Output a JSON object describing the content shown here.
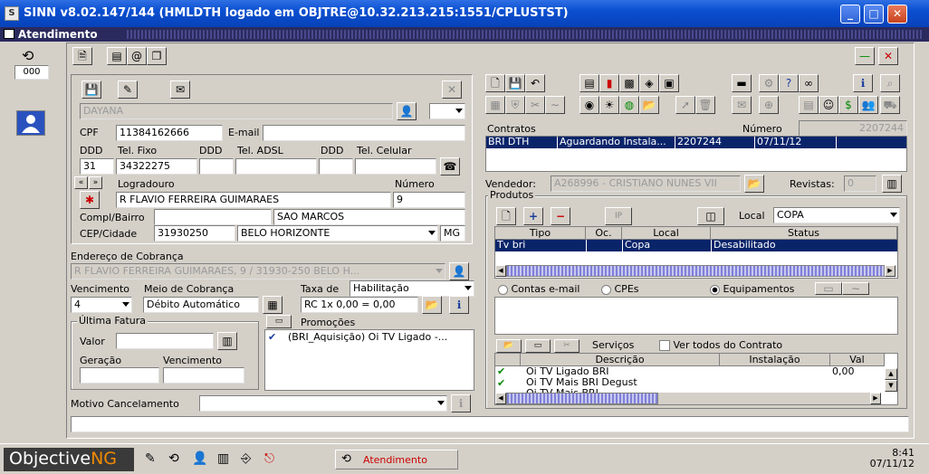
{
  "window": {
    "title": "SINN v8.02.147/144    (HMLDTH logado em OBJTRE@10.32.213.215:1551/CPLUSTST)",
    "subtitle": "Atendimento"
  },
  "left": {
    "counter": "000"
  },
  "customer": {
    "name": "DAYANA",
    "cpf_label": "CPF",
    "cpf": "11384162666",
    "email_label": "E-mail",
    "email": "",
    "ddd_label": "DDD",
    "tel_fixo_label": "Tel. Fixo",
    "ddd2_label": "DDD",
    "tel_adsl_label": "Tel. ADSL",
    "ddd3_label": "DDD",
    "tel_cel_label": "Tel. Celular",
    "ddd": "31",
    "tel_fixo": "34322275",
    "logradouro_label": "Logradouro",
    "numero_label": "Número",
    "logradouro": "R FLAVIO FERREIRA GUIMARAES",
    "numero": "9",
    "compl_label": "Compl/Bairro",
    "bairro": "SAO MARCOS",
    "cep_label": "CEP/Cidade",
    "cep": "31930250",
    "cidade": "BELO HORIZONTE",
    "uf": "MG"
  },
  "billing": {
    "endereco_label": "Endereço de Cobrança",
    "endereco": "R FLAVIO FERREIRA GUIMARAES, 9  / 31930-250 BELO H...",
    "vencimento_label": "Vencimento",
    "meio_label": "Meio de Cobrança",
    "taxa_label": "Taxa de",
    "taxa_value": "Habilitação",
    "vencimento": "4",
    "meio": "Débito Automático",
    "rc": "RC 1x 0,00 = 0,00",
    "ultima_fatura_label": "Última Fatura",
    "valor_label": "Valor",
    "geracao_label": "Geração",
    "venc2_label": "Vencimento",
    "promocoes_label": "Promoções",
    "promo_item": "(BRI_Aquisição) Oi TV Ligado -...",
    "motivo_label": "Motivo Cancelamento"
  },
  "contracts": {
    "label": "Contratos",
    "numero_label": "Número",
    "numero": "2207244",
    "row": [
      "BRI DTH",
      "Aguardando Instala...",
      "2207244",
      "07/11/12"
    ],
    "vendedor_label": "Vendedor:",
    "vendedor": "A268996 - CRISTIANO NUNES VII",
    "revistas_label": "Revistas:",
    "revistas": "0"
  },
  "produtos": {
    "label": "Produtos",
    "local_label": "Local",
    "local_value": "COPA",
    "headers": [
      "Tipo",
      "Oc.",
      "Local",
      "Status"
    ],
    "row": [
      "Tv bri",
      "",
      "Copa",
      "Desabilitado"
    ],
    "radio_contas": "Contas e-mail",
    "radio_cpes": "CPEs",
    "radio_equip": "Equipamentos"
  },
  "servicos": {
    "label": "Serviços",
    "ver_todos": "Ver todos do Contrato",
    "headers": [
      "Descrição",
      "Instalação",
      "Val"
    ],
    "rows": [
      {
        "desc": "Oi TV Ligado BRI",
        "val": "0,00"
      },
      {
        "desc": "Oi TV Mais BRI Degust",
        "val": ""
      },
      {
        "desc": "Oi TV Mais BRI",
        "val": ""
      }
    ]
  },
  "taskbar": {
    "brand1": "Objective",
    "brand2": "NG",
    "active_task": "Atendimento",
    "time": "8:41",
    "date": "07/11/12"
  },
  "colors": {
    "titlebar": "#0a4fd1",
    "selection": "#0a246a",
    "brand_orange": "#f08a00"
  }
}
